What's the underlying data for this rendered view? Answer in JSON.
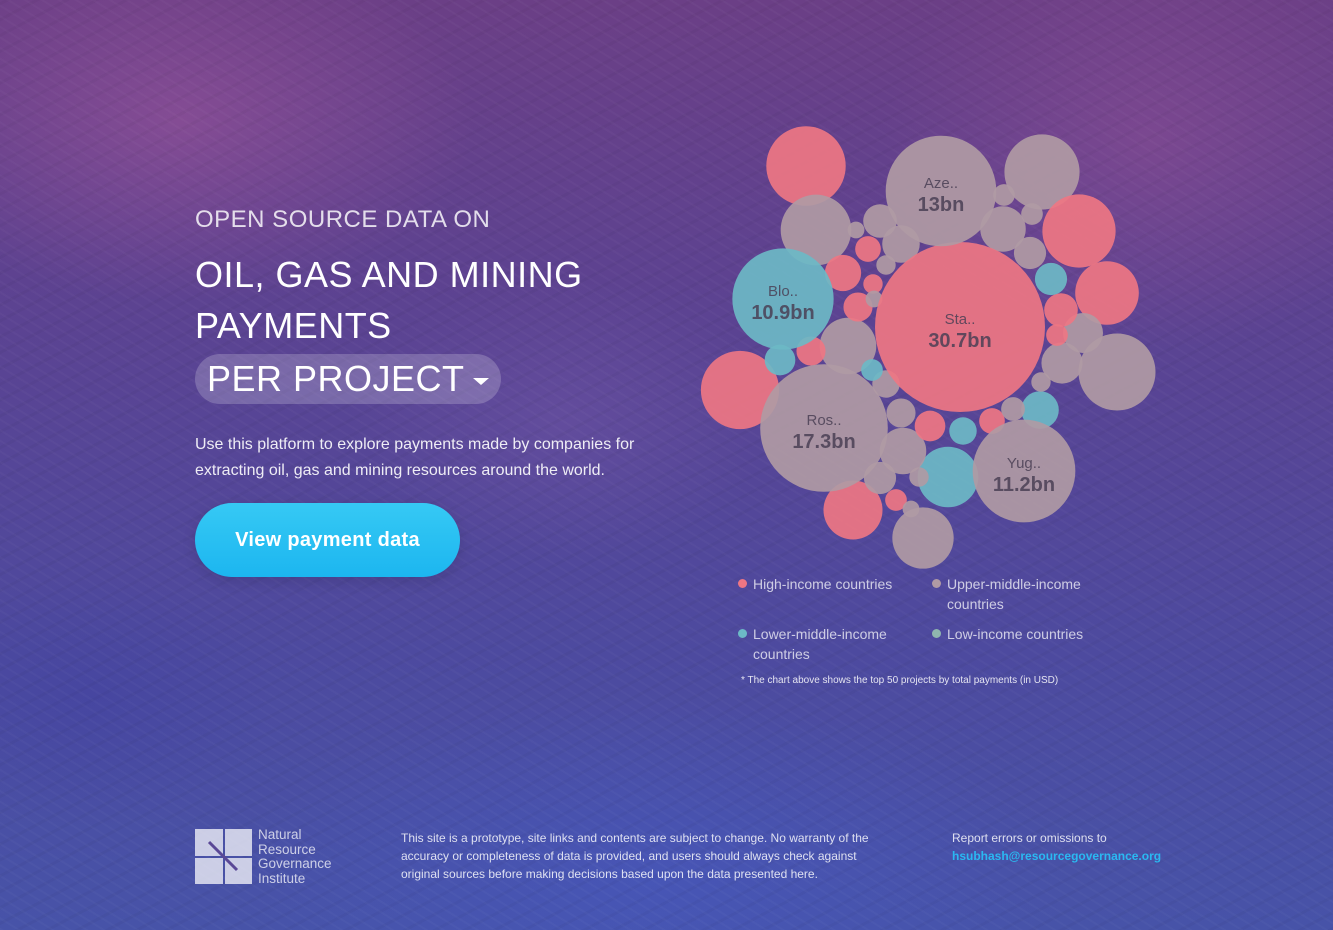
{
  "hero": {
    "eyebrow": "OPEN SOURCE DATA ON",
    "headline": "OIL, GAS AND MINING PAYMENTS",
    "dropdown_value": "PER PROJECT",
    "lead": "Use this platform to explore payments made by companies for extracting oil, gas and mining resources around the world.",
    "cta_label": "View payment data"
  },
  "colors": {
    "high_income": "#ee7683",
    "upper_middle_income": "#b09aa4",
    "lower_middle_income": "#6cb9c6",
    "low_income": "#8fb6ae",
    "cta": "#1cb6f0",
    "link": "#2ab9f2"
  },
  "chart_data": {
    "type": "bubble",
    "categories": [
      "High-income countries",
      "Upper-middle-income countries",
      "Lower-middle-income countries",
      "Low-income countries"
    ],
    "labeled_bubbles": [
      {
        "name": "Sta..",
        "value_label": "30.7bn",
        "value": 30.7,
        "category": "high"
      },
      {
        "name": "Ros..",
        "value_label": "17.3bn",
        "value": 17.3,
        "category": "upper"
      },
      {
        "name": "Aze..",
        "value_label": "13bn",
        "value": 13.0,
        "category": "upper"
      },
      {
        "name": "Yug..",
        "value_label": "11.2bn",
        "value": 11.2,
        "category": "upper"
      },
      {
        "name": "Blo..",
        "value_label": "10.9bn",
        "value": 10.9,
        "category": "lower"
      }
    ],
    "unlabeled_bubbles": [
      {
        "value": 6.7,
        "category": "high"
      },
      {
        "value": 6.5,
        "category": "high"
      },
      {
        "value": 6.3,
        "category": "upper"
      },
      {
        "value": 6.0,
        "category": "upper"
      },
      {
        "value": 5.7,
        "category": "high"
      },
      {
        "value": 5.3,
        "category": "upper"
      },
      {
        "value": 4.3,
        "category": "high"
      },
      {
        "value": 4.0,
        "category": "upper"
      },
      {
        "value": 3.9,
        "category": "lower"
      },
      {
        "value": 3.7,
        "category": "high"
      },
      {
        "value": 3.4,
        "category": "upper"
      },
      {
        "value": 2.3,
        "category": "upper"
      },
      {
        "value": 2.2,
        "category": "upper"
      },
      {
        "value": 1.8,
        "category": "upper"
      },
      {
        "value": 1.7,
        "category": "upper"
      },
      {
        "value": 1.5,
        "category": "upper"
      },
      {
        "value": 1.5,
        "category": "lower"
      },
      {
        "value": 1.4,
        "category": "high"
      },
      {
        "value": 1.2,
        "category": "upper"
      },
      {
        "value": 1.2,
        "category": "high"
      },
      {
        "value": 1.1,
        "category": "upper"
      },
      {
        "value": 1.1,
        "category": "upper"
      },
      {
        "value": 1.1,
        "category": "lower"
      },
      {
        "value": 1.0,
        "category": "lower"
      },
      {
        "value": 1.0,
        "category": "high"
      },
      {
        "value": 0.9,
        "category": "high"
      },
      {
        "value": 0.9,
        "category": "high"
      },
      {
        "value": 0.9,
        "category": "upper"
      },
      {
        "value": 0.8,
        "category": "upper"
      },
      {
        "value": 0.8,
        "category": "lower"
      },
      {
        "value": 0.7,
        "category": "high"
      },
      {
        "value": 0.7,
        "category": "high"
      },
      {
        "value": 0.6,
        "category": "upper"
      },
      {
        "value": 0.5,
        "category": "lower"
      },
      {
        "value": 0.5,
        "category": "high"
      },
      {
        "value": 0.5,
        "category": "upper"
      },
      {
        "value": 0.5,
        "category": "upper"
      },
      {
        "value": 0.5,
        "category": "high"
      },
      {
        "value": 0.4,
        "category": "upper"
      },
      {
        "value": 0.4,
        "category": "upper"
      },
      {
        "value": 0.4,
        "category": "high"
      },
      {
        "value": 0.4,
        "category": "upper"
      },
      {
        "value": 0.3,
        "category": "upper"
      },
      {
        "value": 0.3,
        "category": "upper"
      },
      {
        "value": 0.3,
        "category": "upper"
      }
    ],
    "note": "* The chart above shows the top 50 projects by total payments (in USD)"
  },
  "legend": {
    "high": "High-income countries",
    "upper": "Upper-middle-income countries",
    "lower": "Lower-middle-income countries",
    "low": "Low-income countries"
  },
  "footer": {
    "logo_lines": [
      "Natural",
      "Resource",
      "Governance",
      "Institute"
    ],
    "disclaimer": "This site is a prototype, site links and contents are subject to change. No warranty of the accuracy or completeness of data is provided, and users should always check against original sources before making decisions based upon the data presented here.",
    "report_label": "Report errors or omissions to",
    "report_email": "hsubhash@resourcegovernance.org"
  }
}
